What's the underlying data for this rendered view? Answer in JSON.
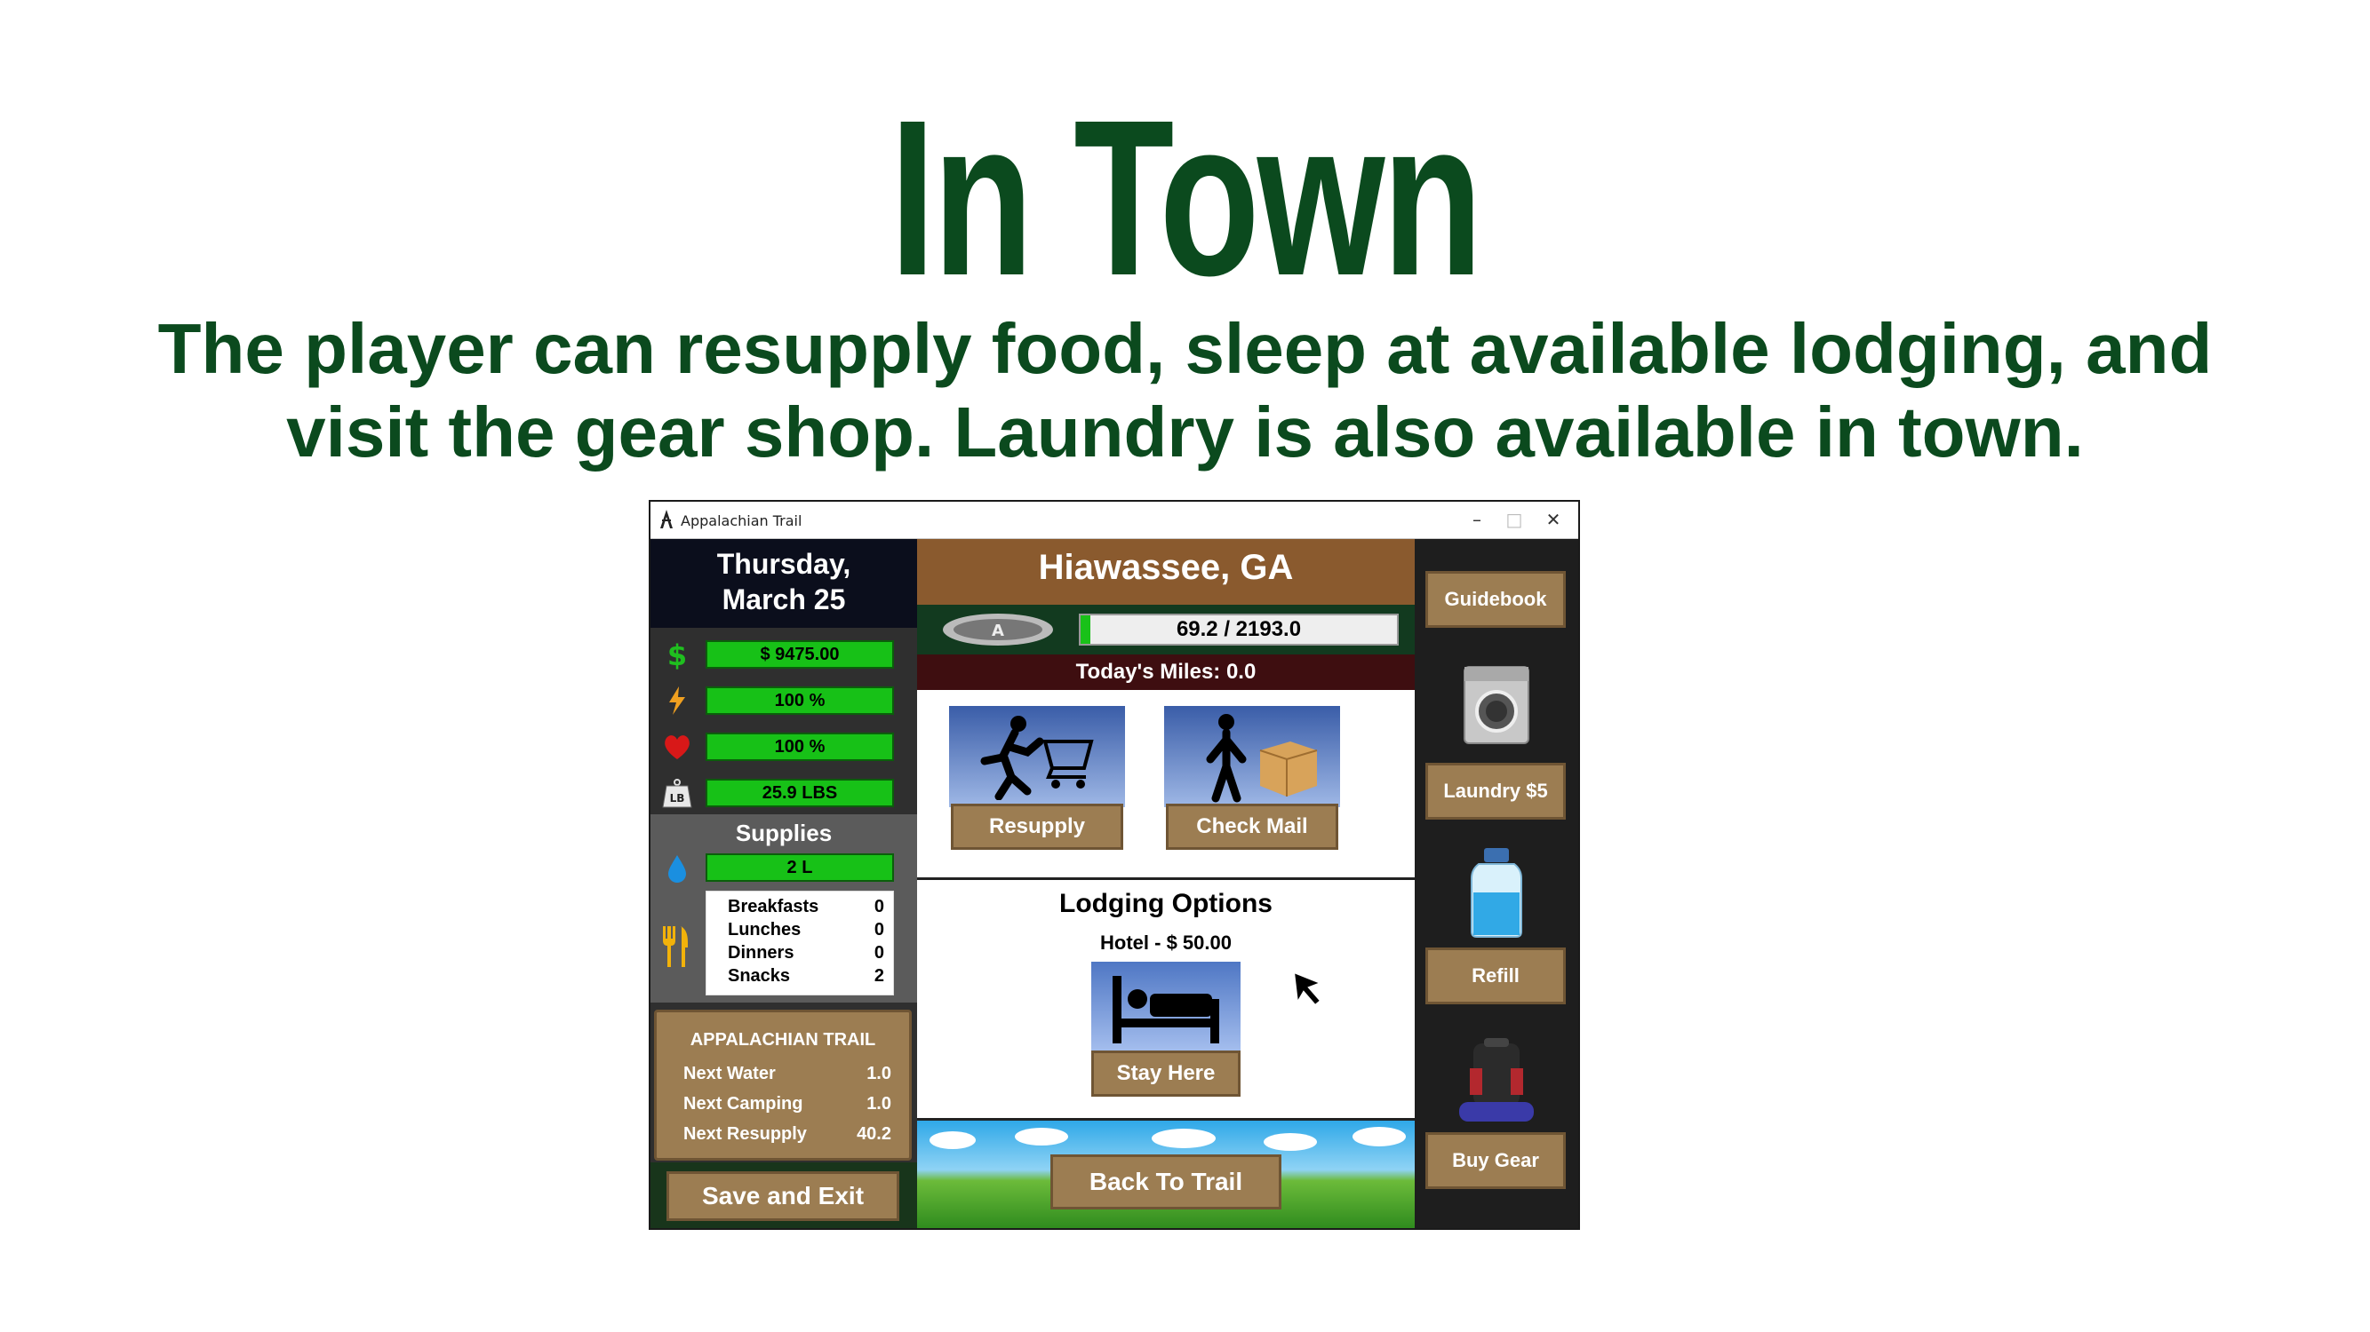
{
  "slide": {
    "title": "In Town",
    "subtitle_line1": "The player can resupply food, sleep at available lodging, and",
    "subtitle_line2": "visit the gear shop.  Laundry is also available in town."
  },
  "window": {
    "title": "Appalachian Trail",
    "minimize": "–",
    "maximize": "□",
    "close": "✕"
  },
  "left": {
    "date_line1": "Thursday,",
    "date_line2": "March 25",
    "stats": {
      "money": "$ 9475.00",
      "energy": "100 %",
      "health": "100 %",
      "weight": "25.9 LBS"
    },
    "weight_icon_label": "LB",
    "supplies_title": "Supplies",
    "water": "2 L",
    "meals": [
      {
        "label": "Breakfasts",
        "qty": "0"
      },
      {
        "label": "Lunches",
        "qty": "0"
      },
      {
        "label": "Dinners",
        "qty": "0"
      },
      {
        "label": "Snacks",
        "qty": "2"
      }
    ],
    "trail_sign": {
      "title": "APPALACHIAN TRAIL",
      "rows": [
        {
          "label": "Next Water",
          "value": "1.0"
        },
        {
          "label": "Next Camping",
          "value": "1.0"
        },
        {
          "label": "Next Resupply",
          "value": "40.2"
        }
      ]
    },
    "save_exit": "Save and Exit"
  },
  "center": {
    "town": "Hiawassee, GA",
    "progress_text": "69.2 / 2193.0",
    "progress_fraction": 0.0316,
    "todays_miles": "Today's Miles: 0.0",
    "resupply": "Resupply",
    "check_mail": "Check Mail",
    "lodging_title": "Lodging Options",
    "hotel": "Hotel - $ 50.00",
    "stay_here": "Stay Here",
    "back_to_trail": "Back To Trail"
  },
  "right": {
    "guidebook": "Guidebook",
    "laundry": "Laundry $5",
    "refill": "Refill",
    "buy_gear": "Buy Gear"
  },
  "colors": {
    "title_green": "#0b4a1e",
    "bar_green": "#17c117",
    "wood": "#9c7d52"
  }
}
